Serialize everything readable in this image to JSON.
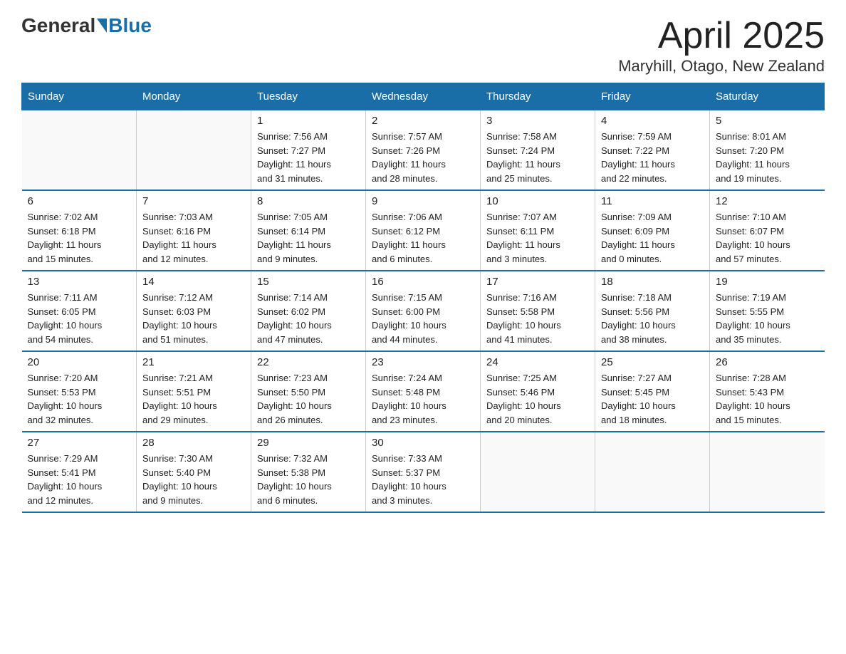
{
  "logo": {
    "general": "General",
    "blue": "Blue"
  },
  "title": "April 2025",
  "subtitle": "Maryhill, Otago, New Zealand",
  "weekdays": [
    "Sunday",
    "Monday",
    "Tuesday",
    "Wednesday",
    "Thursday",
    "Friday",
    "Saturday"
  ],
  "weeks": [
    [
      {
        "day": "",
        "info": ""
      },
      {
        "day": "",
        "info": ""
      },
      {
        "day": "1",
        "info": "Sunrise: 7:56 AM\nSunset: 7:27 PM\nDaylight: 11 hours\nand 31 minutes."
      },
      {
        "day": "2",
        "info": "Sunrise: 7:57 AM\nSunset: 7:26 PM\nDaylight: 11 hours\nand 28 minutes."
      },
      {
        "day": "3",
        "info": "Sunrise: 7:58 AM\nSunset: 7:24 PM\nDaylight: 11 hours\nand 25 minutes."
      },
      {
        "day": "4",
        "info": "Sunrise: 7:59 AM\nSunset: 7:22 PM\nDaylight: 11 hours\nand 22 minutes."
      },
      {
        "day": "5",
        "info": "Sunrise: 8:01 AM\nSunset: 7:20 PM\nDaylight: 11 hours\nand 19 minutes."
      }
    ],
    [
      {
        "day": "6",
        "info": "Sunrise: 7:02 AM\nSunset: 6:18 PM\nDaylight: 11 hours\nand 15 minutes."
      },
      {
        "day": "7",
        "info": "Sunrise: 7:03 AM\nSunset: 6:16 PM\nDaylight: 11 hours\nand 12 minutes."
      },
      {
        "day": "8",
        "info": "Sunrise: 7:05 AM\nSunset: 6:14 PM\nDaylight: 11 hours\nand 9 minutes."
      },
      {
        "day": "9",
        "info": "Sunrise: 7:06 AM\nSunset: 6:12 PM\nDaylight: 11 hours\nand 6 minutes."
      },
      {
        "day": "10",
        "info": "Sunrise: 7:07 AM\nSunset: 6:11 PM\nDaylight: 11 hours\nand 3 minutes."
      },
      {
        "day": "11",
        "info": "Sunrise: 7:09 AM\nSunset: 6:09 PM\nDaylight: 11 hours\nand 0 minutes."
      },
      {
        "day": "12",
        "info": "Sunrise: 7:10 AM\nSunset: 6:07 PM\nDaylight: 10 hours\nand 57 minutes."
      }
    ],
    [
      {
        "day": "13",
        "info": "Sunrise: 7:11 AM\nSunset: 6:05 PM\nDaylight: 10 hours\nand 54 minutes."
      },
      {
        "day": "14",
        "info": "Sunrise: 7:12 AM\nSunset: 6:03 PM\nDaylight: 10 hours\nand 51 minutes."
      },
      {
        "day": "15",
        "info": "Sunrise: 7:14 AM\nSunset: 6:02 PM\nDaylight: 10 hours\nand 47 minutes."
      },
      {
        "day": "16",
        "info": "Sunrise: 7:15 AM\nSunset: 6:00 PM\nDaylight: 10 hours\nand 44 minutes."
      },
      {
        "day": "17",
        "info": "Sunrise: 7:16 AM\nSunset: 5:58 PM\nDaylight: 10 hours\nand 41 minutes."
      },
      {
        "day": "18",
        "info": "Sunrise: 7:18 AM\nSunset: 5:56 PM\nDaylight: 10 hours\nand 38 minutes."
      },
      {
        "day": "19",
        "info": "Sunrise: 7:19 AM\nSunset: 5:55 PM\nDaylight: 10 hours\nand 35 minutes."
      }
    ],
    [
      {
        "day": "20",
        "info": "Sunrise: 7:20 AM\nSunset: 5:53 PM\nDaylight: 10 hours\nand 32 minutes."
      },
      {
        "day": "21",
        "info": "Sunrise: 7:21 AM\nSunset: 5:51 PM\nDaylight: 10 hours\nand 29 minutes."
      },
      {
        "day": "22",
        "info": "Sunrise: 7:23 AM\nSunset: 5:50 PM\nDaylight: 10 hours\nand 26 minutes."
      },
      {
        "day": "23",
        "info": "Sunrise: 7:24 AM\nSunset: 5:48 PM\nDaylight: 10 hours\nand 23 minutes."
      },
      {
        "day": "24",
        "info": "Sunrise: 7:25 AM\nSunset: 5:46 PM\nDaylight: 10 hours\nand 20 minutes."
      },
      {
        "day": "25",
        "info": "Sunrise: 7:27 AM\nSunset: 5:45 PM\nDaylight: 10 hours\nand 18 minutes."
      },
      {
        "day": "26",
        "info": "Sunrise: 7:28 AM\nSunset: 5:43 PM\nDaylight: 10 hours\nand 15 minutes."
      }
    ],
    [
      {
        "day": "27",
        "info": "Sunrise: 7:29 AM\nSunset: 5:41 PM\nDaylight: 10 hours\nand 12 minutes."
      },
      {
        "day": "28",
        "info": "Sunrise: 7:30 AM\nSunset: 5:40 PM\nDaylight: 10 hours\nand 9 minutes."
      },
      {
        "day": "29",
        "info": "Sunrise: 7:32 AM\nSunset: 5:38 PM\nDaylight: 10 hours\nand 6 minutes."
      },
      {
        "day": "30",
        "info": "Sunrise: 7:33 AM\nSunset: 5:37 PM\nDaylight: 10 hours\nand 3 minutes."
      },
      {
        "day": "",
        "info": ""
      },
      {
        "day": "",
        "info": ""
      },
      {
        "day": "",
        "info": ""
      }
    ]
  ]
}
